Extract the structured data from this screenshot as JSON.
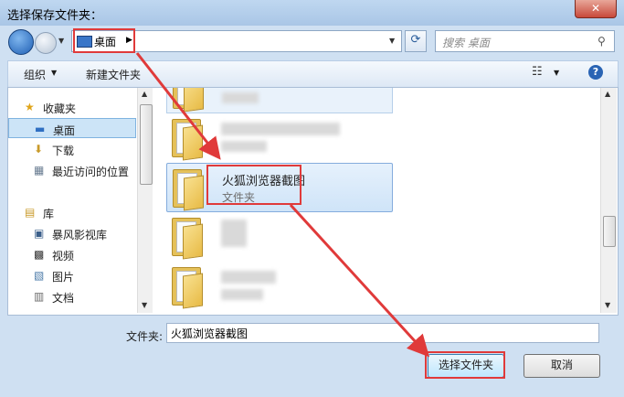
{
  "window": {
    "title": "选择保存文件夹：",
    "close_label": "✕"
  },
  "nav": {
    "address": "桌面",
    "search_placeholder": "搜索 桌面"
  },
  "toolbar": {
    "organize": "组织",
    "new_folder": "新建文件夹"
  },
  "sidebar": {
    "items": [
      {
        "label": "收藏夹",
        "icon": "star-icon",
        "glyph": "★"
      },
      {
        "label": "桌面",
        "icon": "desktop-icon",
        "glyph": "▬"
      },
      {
        "label": "下载",
        "icon": "download-icon",
        "glyph": "⬇"
      },
      {
        "label": "最近访问的位置",
        "icon": "recent-places-icon",
        "glyph": "▦"
      },
      {
        "label": "库",
        "icon": "library-icon",
        "glyph": "▤"
      },
      {
        "label": "暴风影视库",
        "icon": "media-library-icon",
        "glyph": "▣"
      },
      {
        "label": "视频",
        "icon": "video-icon",
        "glyph": "▩"
      },
      {
        "label": "图片",
        "icon": "pictures-icon",
        "glyph": "▧"
      },
      {
        "label": "文档",
        "icon": "documents-icon",
        "glyph": "▥"
      }
    ]
  },
  "content": {
    "selected_folder": {
      "name": "火狐浏览器截图",
      "type": "文件夹"
    }
  },
  "footer": {
    "folder_label": "文件夹:",
    "folder_value": "火狐浏览器截图",
    "select_button": "选择文件夹",
    "cancel_button": "取消"
  },
  "colors": {
    "highlight": "#e03a3a",
    "selection": "#cce4f7"
  }
}
